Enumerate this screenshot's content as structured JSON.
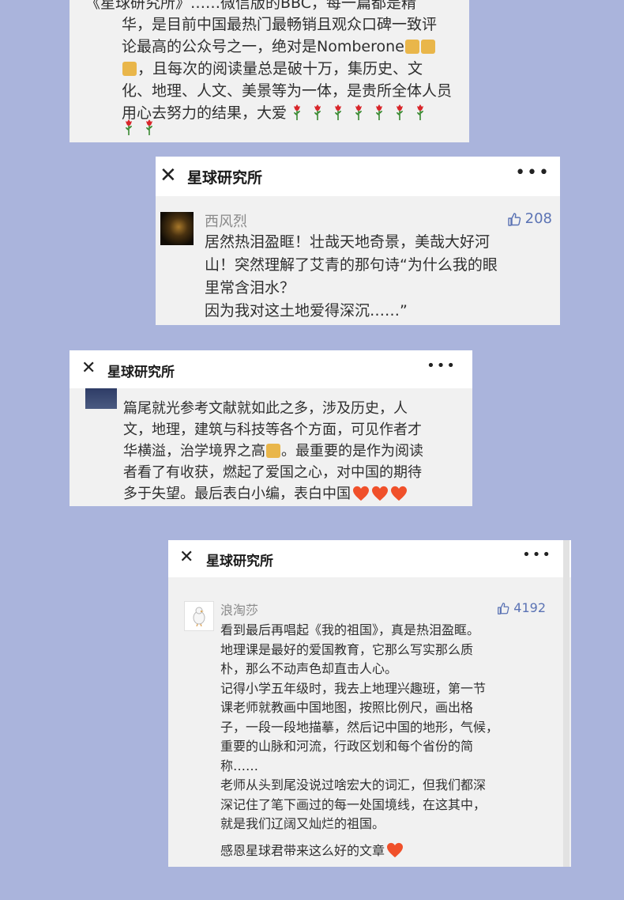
{
  "card1": {
    "top_line": "《星球研究所》……微信版的BBC，每一篇都是精",
    "lines": [
      "华，是目前中国最热门最畅销且观众口碑一致评",
      "论最高的公众号之一，绝对是Nomberone",
      "，且每次的阅读量总是破十万，集历史、文",
      "化、地理、人文、美景等为一体，是贵所全体人员",
      "用心去努力的结果，大爱"
    ]
  },
  "card2": {
    "title": "星球研究所",
    "author": "西风烈",
    "likes": "208",
    "comment": "居然热泪盈眶！壮哉天地奇景，美哉大好河\n山！突然理解了艾青的那句诗“为什么我的眼\n里常含泪水？\n因为我对这土地爱得深沉……”"
  },
  "card3": {
    "title": "星球研究所",
    "lines": [
      "篇尾就光参考文献就如此之多，涉及历史，人",
      "文，地理，建筑与科技等各个方面，可见作者才",
      "华横溢，治学境界之高",
      "。最重要的是作为阅读",
      "者看了有收获，燃起了爱国之心，对中国的期待",
      "多于失望。最后表白小编，表白中国"
    ]
  },
  "card4": {
    "title": "星球研究所",
    "author": "浪淘莎",
    "likes": "4192",
    "comment": "看到最后再唱起《我的祖国》，真是热泪盈眶。\n地理课是最好的爱国教育，它那么写实那么质\n朴，那么不动声色却直击人心。\n记得小学五年级时，我去上地理兴趣班，第一节\n课老师就教画中国地图，按照比例尺，画出格\n子，一段一段地描摹，然后记中国的地形，气候，\n重要的山脉和河流，行政区划和每个省份的简\n称……\n老师从头到尾没说过啥宏大的词汇，但我们都深\n深记住了笔下画过的每一处国境线，在这其中，\n就是我们辽阔又灿烂的祖国。",
    "last_line": "感恩星球君带来这么好的文章"
  },
  "colors": {
    "background": "#aab4dc",
    "card": "#f1f1f1",
    "like_blue": "#5b73b4"
  }
}
